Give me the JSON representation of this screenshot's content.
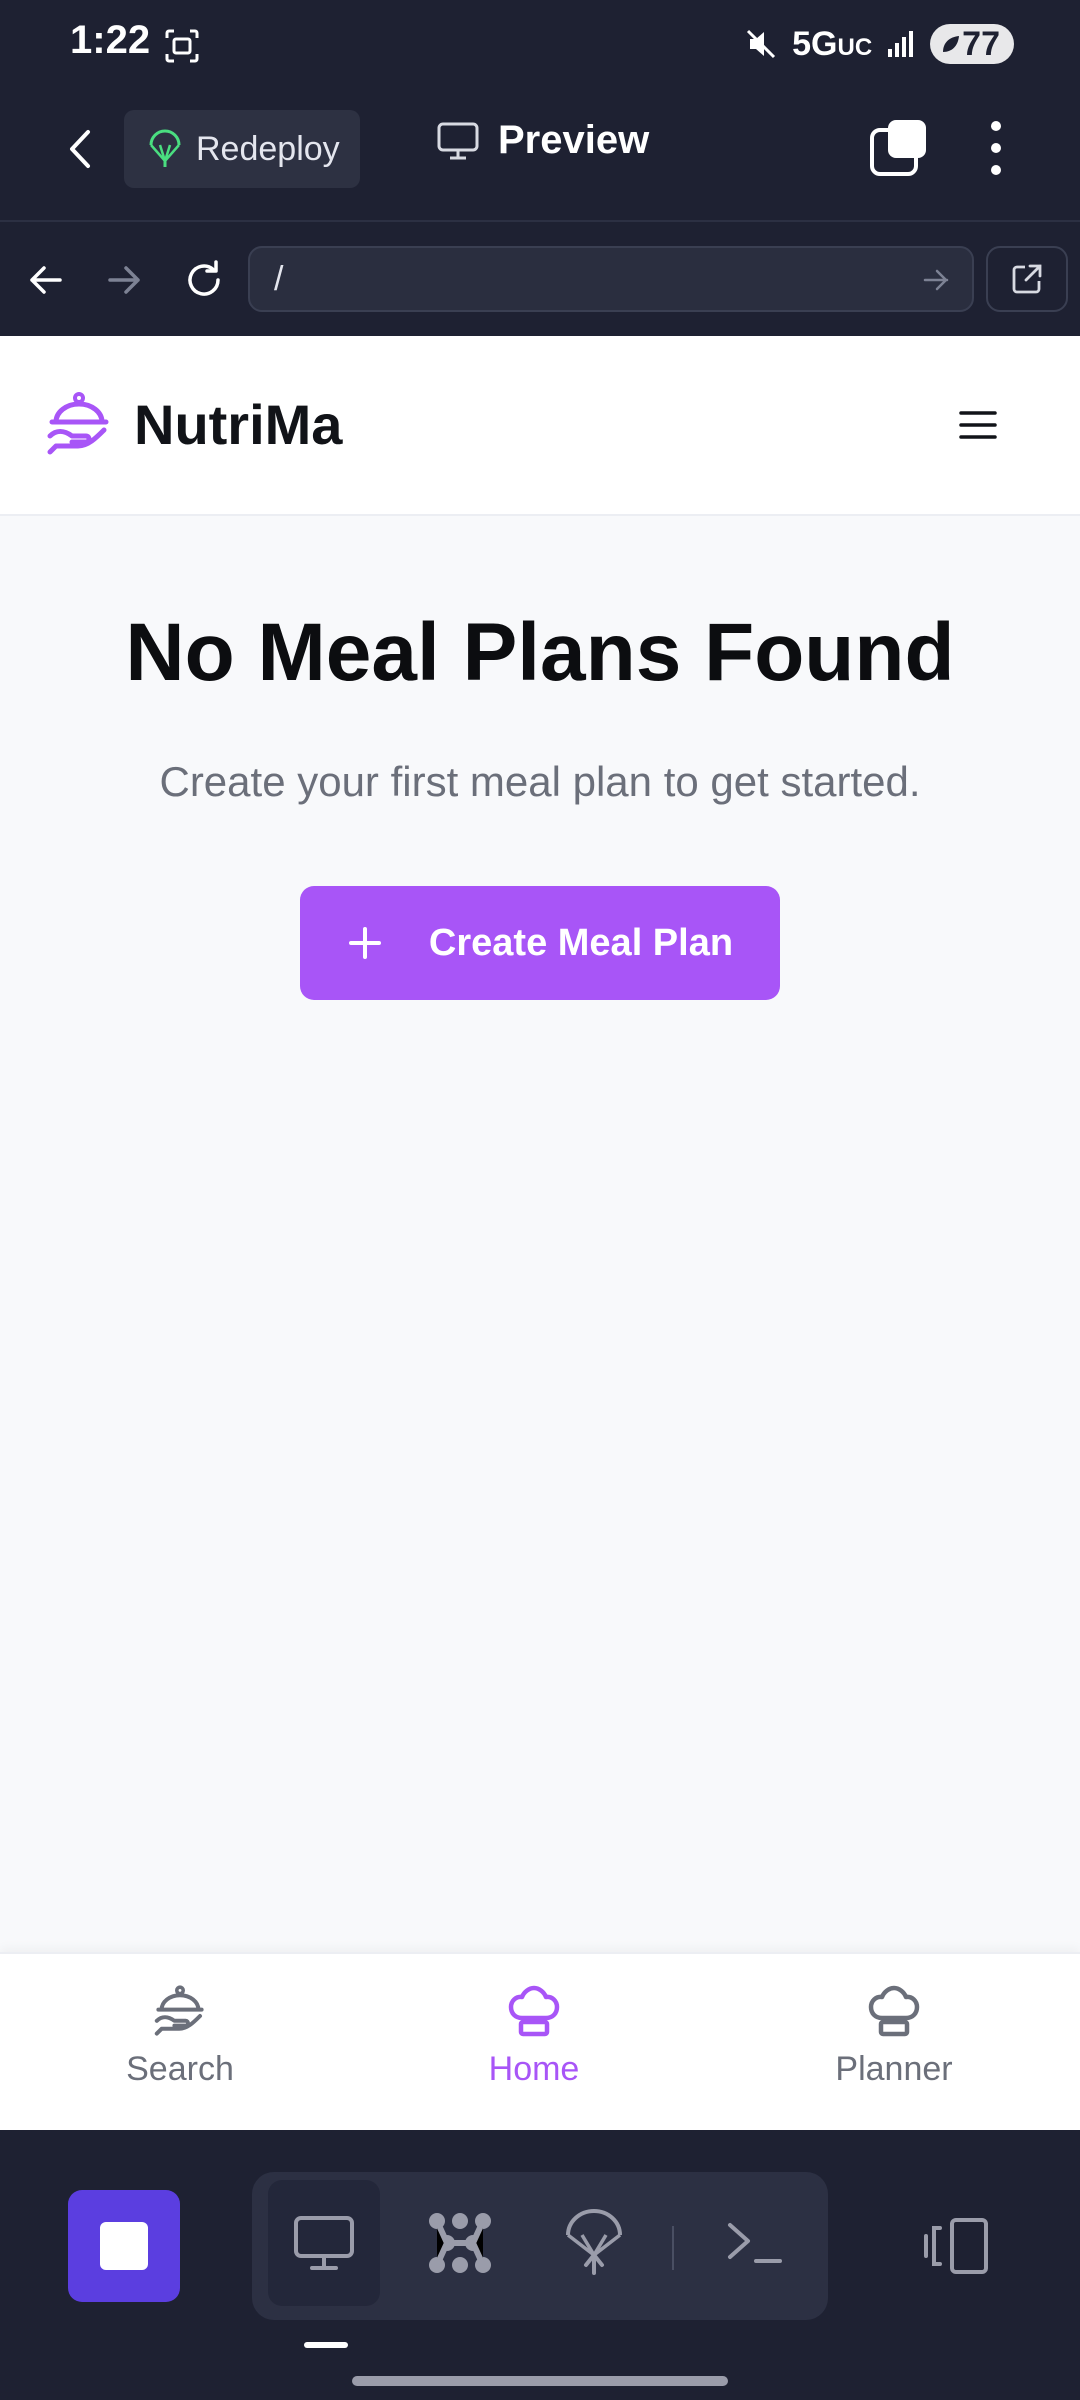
{
  "status": {
    "time": "1:22",
    "network": "5G",
    "network_suffix": "UC",
    "battery": "77"
  },
  "app_bar": {
    "redeploy_label": "Redeploy",
    "preview_label": "Preview"
  },
  "url_bar": {
    "value": "/"
  },
  "site": {
    "brand": "NutriMa"
  },
  "empty_state": {
    "title": "No Meal Plans Found",
    "subtitle": "Create your first meal plan to get started.",
    "button_label": "Create Meal Plan"
  },
  "bottom_nav": {
    "items": [
      {
        "label": "Search",
        "icon": "serving-dish-icon"
      },
      {
        "label": "Home",
        "icon": "chef-hat-icon",
        "active": true
      },
      {
        "label": "Planner",
        "icon": "chef-hat-icon"
      }
    ]
  },
  "colors": {
    "accent": "#a855f7",
    "ide_bg": "#1e2132",
    "stop": "#5b3ee0"
  }
}
